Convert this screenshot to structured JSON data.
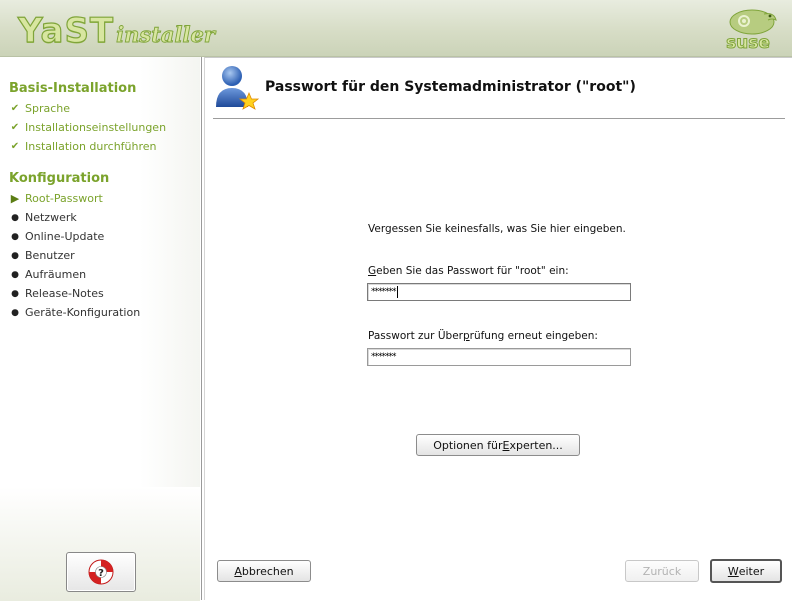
{
  "header": {
    "logo_big": "YaST",
    "logo_small": "installer",
    "brand": "suse"
  },
  "sidebar": {
    "section1_title": "Basis-Installation",
    "section1_items": [
      {
        "label": "Sprache",
        "status": "done"
      },
      {
        "label": "Installationseinstellungen",
        "status": "done"
      },
      {
        "label": "Installation durchführen",
        "status": "done"
      }
    ],
    "section2_title": "Konfiguration",
    "section2_items": [
      {
        "label": "Root-Passwort",
        "status": "current"
      },
      {
        "label": "Netzwerk",
        "status": "pending"
      },
      {
        "label": "Online-Update",
        "status": "pending"
      },
      {
        "label": "Benutzer",
        "status": "pending"
      },
      {
        "label": "Aufräumen",
        "status": "pending"
      },
      {
        "label": "Release-Notes",
        "status": "pending"
      },
      {
        "label": "Geräte-Konfiguration",
        "status": "pending"
      }
    ],
    "help_icon": "lifebuoy-help-icon"
  },
  "dialog": {
    "title": "Passwort für den Systemadministrator (\"root\")",
    "hint": "Vergessen Sie keinesfalls, was Sie hier eingeben.",
    "password_label_accel": "G",
    "password_label_rest": "eben Sie das Passwort für \"root\" ein:",
    "password_value": "*******",
    "verify_label_pre": "Passwort zur Über",
    "verify_label_accel": "p",
    "verify_label_post": "rüfung erneut eingeben:",
    "verify_value": "*******",
    "expert_btn_pre": "Optionen für ",
    "expert_btn_accel": "E",
    "expert_btn_post": "xperten..."
  },
  "buttons": {
    "abort_accel": "A",
    "abort_rest": "bbrechen",
    "back": "Zurück",
    "next_accel": "W",
    "next_rest": "eiter"
  },
  "colors": {
    "accent_green": "#7ba32c",
    "header_bg": "#d7ddc6"
  }
}
